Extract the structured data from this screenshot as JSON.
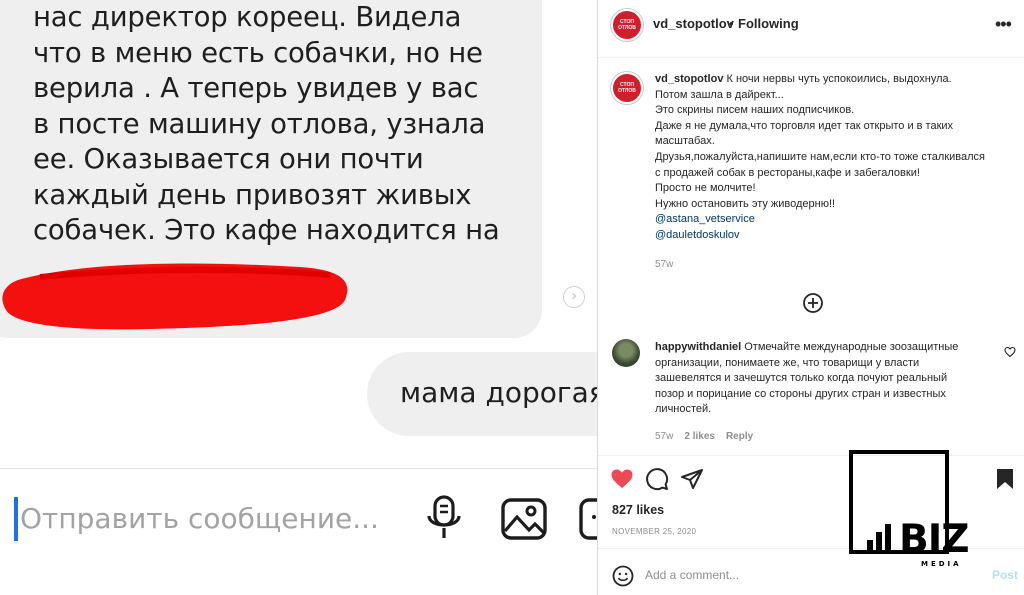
{
  "chat": {
    "incoming_lines": [
      "нас директор кореец. Видела",
      "что в меню есть собачки, но не",
      "верила . А теперь увидев у вас",
      "в посте машину отлова, узнала",
      "ее. Оказывается они почти",
      "каждый день привозят живых",
      "собачек. Это кафе находится на"
    ],
    "outgoing_text": "мама дорогая",
    "composer_placeholder": "Отправить сообщение...",
    "composer_icons": [
      "microphone-icon",
      "image-icon",
      "sticker-icon"
    ]
  },
  "post": {
    "username": "vd_stopotlov",
    "separator": "•",
    "follow_label": "Following",
    "more_icon": "more-horizontal-icon",
    "avatar_text": "СТОП ОТЛОВ",
    "caption_user": "vd_stopotlov",
    "caption_lines": [
      "К ночи нервы чуть успокоились, выдохнула.",
      "Потом зашла в дайрект...",
      "Это скрины писем наших подписчиков.",
      "Даже я не думала,что торговля идет так открыто и в таких",
      "масштабах.",
      "Друзья,пожалуйста,напишите нам,если кто-то тоже сталкивался",
      "с продажей собак в рестораны,кафе и забегаловки!",
      "Просто не молчите!",
      "Нужно остановить эту живодерню!!"
    ],
    "mentions": [
      "@astana_vetservice",
      "@dauletdoskulov"
    ],
    "caption_time": "57w",
    "load_more_icon": "plus-circle-icon",
    "comment": {
      "user": "happywithdaniel",
      "lines": [
        "Отмечайте международные зоозащитные",
        "организации, понимаете же, что товарищи у власти",
        "зашевелятся и зачешутся только когда почуют реальный",
        "позор и порицание со стороны других стран и известных",
        "личностей."
      ],
      "time": "57w",
      "likes": "2 likes",
      "reply": "Reply"
    },
    "likes": "827 likes",
    "date": "NOVEMBER 25, 2020",
    "add_comment_placeholder": "Add a comment...",
    "post_button": "Post",
    "colors": {
      "like": "#ed4956",
      "link": "#00376b",
      "post_disabled": "#b2dffc"
    }
  },
  "watermark": {
    "brand": "BIZ",
    "sub": "MEDIA"
  }
}
